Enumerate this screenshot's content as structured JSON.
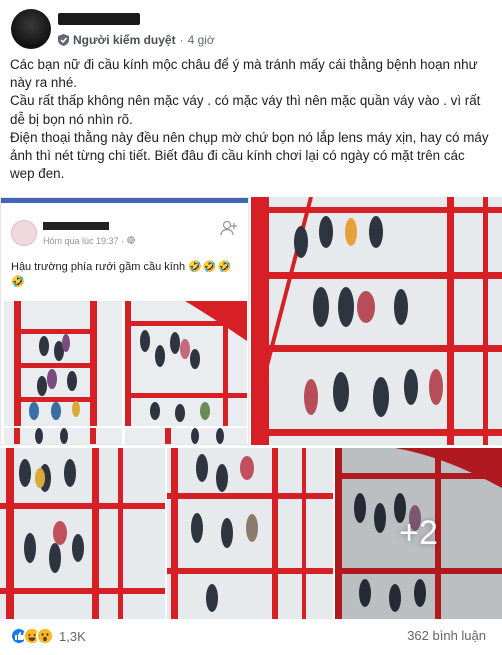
{
  "header": {
    "author_name": "",
    "moderator_label": "Người kiểm duyệt",
    "separator": "·",
    "time": "4 giờ",
    "icons": {
      "avatar": "avatar",
      "moderator": "shield-icon"
    }
  },
  "post": {
    "paragraphs": [
      "Các bạn nữ đi cầu kính mộc châu để ý mà tránh mấy cái thằng bệnh hoạn như này ra nhé.",
      "Cầu rất thấp không nên mặc váy . có mặc váy thì nên mặc quần váy vào . vì rất dễ bị bọn nó nhìn rõ.",
      "Điện thoại thằng này đều nên chụp mờ chứ bọn nó lắp lens máy xịn, hay có máy ảnh thì nét từng chi tiết. Biết đâu đi cầu kính chơi lại có ngày có mặt trên các wep đen."
    ]
  },
  "gallery": {
    "shared_post": {
      "time": "Hôm qua lúc 19:37 ·",
      "caption": "Hậu trường phía rưới gầm cầu kính",
      "emojis": "🤣🤣🤣🤣",
      "icons": [
        "globe-icon",
        "add-friend-icon"
      ]
    },
    "more_count": "+2",
    "colors": {
      "bridge_red": "#d71f26",
      "sky": "#e6ebef",
      "accent": "#4267b2"
    }
  },
  "footer": {
    "reaction_count": "1,3K",
    "comments": "362 bình luận",
    "reactions": [
      "like",
      "haha",
      "wow"
    ]
  }
}
